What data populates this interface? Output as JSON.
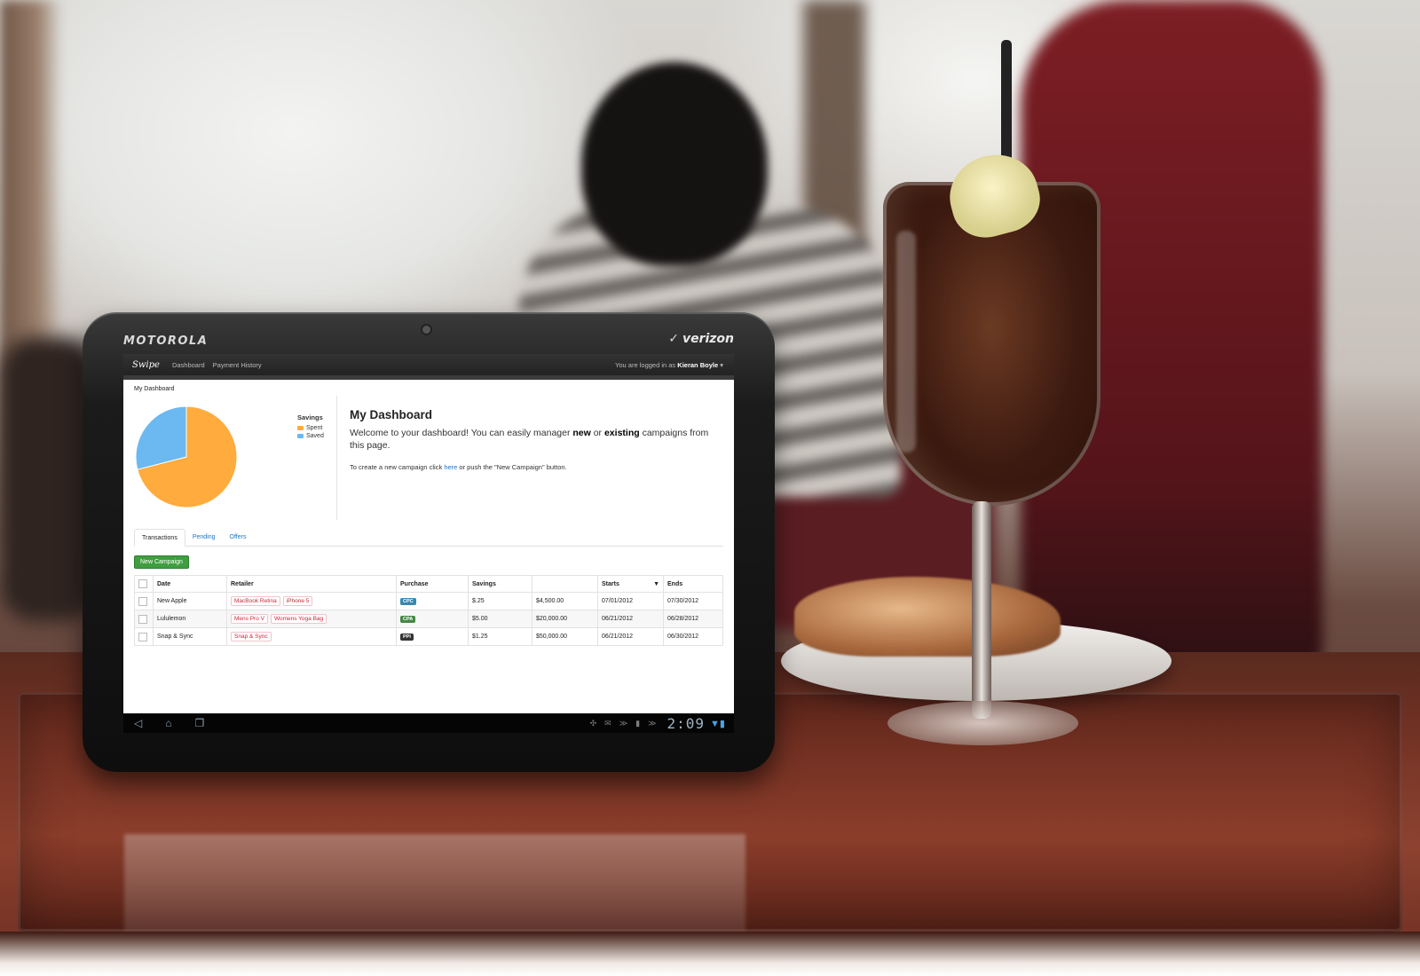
{
  "device": {
    "brand": "MOTOROLA",
    "carrier": "verizon",
    "clock": "2:09"
  },
  "navbar": {
    "brand": "Swipe",
    "links": [
      "Dashboard",
      "Payment History"
    ],
    "login_prefix": "You are logged in as",
    "user": "Kieran Boyle"
  },
  "breadcrumb": "My Dashboard",
  "chart_data": {
    "type": "pie",
    "title": "Savings",
    "series": [
      {
        "name": "Spent",
        "value": 71,
        "color": "#ffab3d"
      },
      {
        "name": "Saved",
        "value": 29,
        "color": "#6cb8f0"
      }
    ]
  },
  "intro": {
    "title": "My Dashboard",
    "welcome_1": "Welcome to your dashboard! You can easily manager ",
    "welcome_new": "new",
    "welcome_or": " or ",
    "welcome_existing": "existing",
    "welcome_2": " campaigns from this page.",
    "create_1": "To create a new campaign click ",
    "create_link": "here",
    "create_2": " or push the \"New Campaign\" button."
  },
  "tabs": [
    "Transactions",
    "Pending",
    "Offers"
  ],
  "new_campaign_label": "New Campaign",
  "table": {
    "headers": [
      "Date",
      "Retailer",
      "Purchase",
      "Savings",
      "",
      "Starts",
      "Ends"
    ],
    "rows": [
      {
        "date": "New Apple",
        "retailer": [
          "MacBook Retina",
          "iPhone 5"
        ],
        "purchase": "CPC",
        "purchase_color": "#3a87ad",
        "savings": "$.25",
        "amount": "$4,500.00",
        "starts": "07/01/2012",
        "ends": "07/30/2012"
      },
      {
        "date": "Lululemon",
        "retailer": [
          "Mens Pro V",
          "Womens Yoga Bag"
        ],
        "purchase": "CPA",
        "purchase_color": "#468847",
        "savings": "$5.00",
        "amount": "$20,000.00",
        "starts": "06/21/2012",
        "ends": "06/28/2012"
      },
      {
        "date": "Snap & Sync",
        "retailer": [
          "Snap & Sync"
        ],
        "purchase": "PPI",
        "purchase_color": "#333333",
        "savings": "$1.25",
        "amount": "$50,000.00",
        "starts": "06/21/2012",
        "ends": "06/30/2012"
      }
    ]
  }
}
